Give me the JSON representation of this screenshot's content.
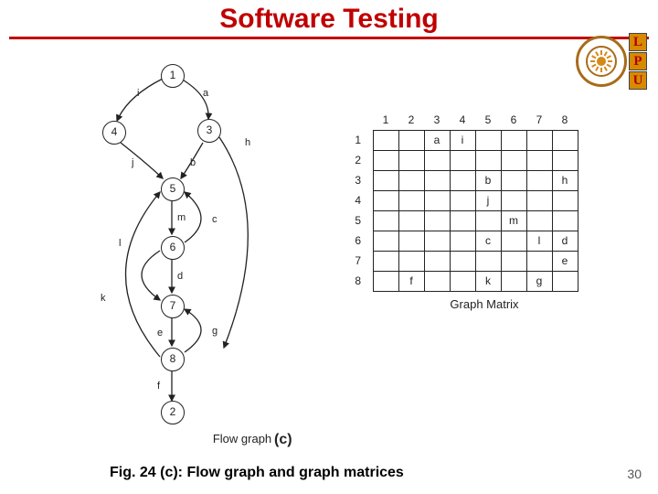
{
  "title": "Software Testing",
  "logo_letters": [
    "L",
    "P",
    "U"
  ],
  "flow_graph": {
    "caption": "Flow graph",
    "nodes": {
      "n1": "1",
      "n2": "2",
      "n3": "3",
      "n4": "4",
      "n5": "5",
      "n6": "6",
      "n7": "7",
      "n8": "8"
    },
    "edge_labels": {
      "a": "a",
      "b": "b",
      "c": "c",
      "d": "d",
      "e": "e",
      "f": "f",
      "g": "g",
      "h": "h",
      "i": "i",
      "j": "j",
      "k": "k",
      "l": "l",
      "m": "m"
    }
  },
  "sub_label": "(c)",
  "matrix": {
    "caption": "Graph Matrix",
    "cols": [
      "1",
      "2",
      "3",
      "4",
      "5",
      "6",
      "7",
      "8"
    ],
    "rows": [
      "1",
      "2",
      "3",
      "4",
      "5",
      "6",
      "7",
      "8"
    ],
    "cells": {
      "1": [
        "",
        "",
        "a",
        "i",
        "",
        "",
        "",
        ""
      ],
      "2": [
        "",
        "",
        "",
        "",
        "",
        "",
        "",
        ""
      ],
      "3": [
        "",
        "",
        "",
        "",
        "b",
        "",
        "",
        "h"
      ],
      "4": [
        "",
        "",
        "",
        "",
        "j",
        "",
        "",
        ""
      ],
      "5": [
        "",
        "",
        "",
        "",
        "",
        "m",
        "",
        ""
      ],
      "6": [
        "",
        "",
        "",
        "",
        "c",
        "",
        "l",
        "d"
      ],
      "7": [
        "",
        "",
        "",
        "",
        "",
        "",
        "",
        "e"
      ],
      "8": [
        "",
        "f",
        "",
        "",
        "k",
        "",
        "g",
        ""
      ]
    }
  },
  "caption": "Fig. 24 (c): Flow graph and graph matrices",
  "page_number": "30"
}
